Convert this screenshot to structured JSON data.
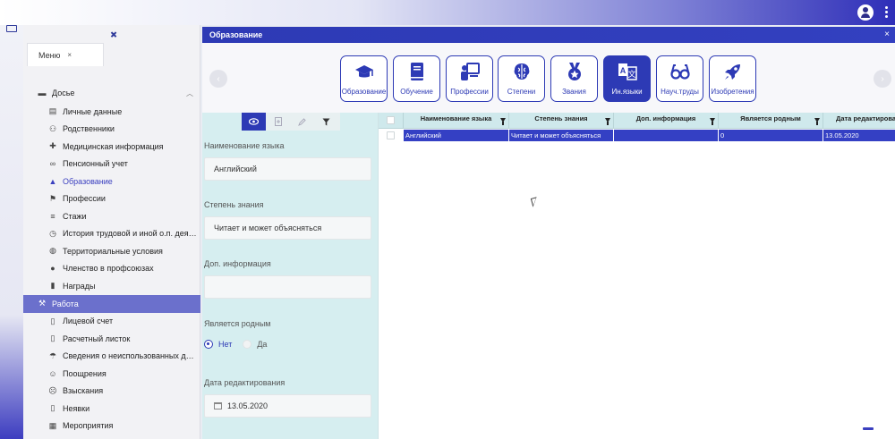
{
  "sidebar": {
    "menu_tab": "Меню",
    "close": "×",
    "items": [
      {
        "type": "group",
        "label": "Досье",
        "icon": "folder-icon",
        "expanded": true
      },
      {
        "type": "item",
        "label": "Личные данные",
        "icon": "id-card-icon"
      },
      {
        "type": "item",
        "label": "Родственники",
        "icon": "people-icon"
      },
      {
        "type": "item",
        "label": "Медицинская информация",
        "icon": "medical-icon"
      },
      {
        "type": "item",
        "label": "Пенсионный учет",
        "icon": "glasses-icon"
      },
      {
        "type": "item",
        "label": "Образование",
        "icon": "graduation-cap-icon",
        "active": true
      },
      {
        "type": "item",
        "label": "Профессии",
        "icon": "profession-icon"
      },
      {
        "type": "item",
        "label": "Стажи",
        "icon": "list-icon"
      },
      {
        "type": "item",
        "label": "История трудовой и иной о.п. дея…",
        "icon": "history-icon"
      },
      {
        "type": "item",
        "label": "Территориальные условия",
        "icon": "globe-icon"
      },
      {
        "type": "item",
        "label": "Членство в профсоюзах",
        "icon": "person-icon"
      },
      {
        "type": "item",
        "label": "Награды",
        "icon": "award-icon"
      },
      {
        "type": "group",
        "label": "Работа",
        "icon": "work-icon",
        "selected": true
      },
      {
        "type": "item",
        "label": "Лицевой счет",
        "icon": "document-icon"
      },
      {
        "type": "item",
        "label": "Расчетный листок",
        "icon": "document-icon"
      },
      {
        "type": "item",
        "label": "Сведения о неиспользованных д…",
        "icon": "beach-icon"
      },
      {
        "type": "item",
        "label": "Поощрения",
        "icon": "smile-icon"
      },
      {
        "type": "item",
        "label": "Взыскания",
        "icon": "frown-icon"
      },
      {
        "type": "item",
        "label": "Неявки",
        "icon": "document-icon"
      },
      {
        "type": "item",
        "label": "Мероприятия",
        "icon": "calendar-icon"
      }
    ]
  },
  "panel": {
    "title": "Образование",
    "close": "×"
  },
  "tabs": [
    {
      "label": "Образование",
      "icon": "graduation-cap-icon"
    },
    {
      "label": "Обучение",
      "icon": "book-icon"
    },
    {
      "label": "Профессии",
      "icon": "presentation-icon"
    },
    {
      "label": "Степени",
      "icon": "brain-icon"
    },
    {
      "label": "Звания",
      "icon": "medal-icon"
    },
    {
      "label": "Ин.языки",
      "icon": "translate-icon",
      "active": true
    },
    {
      "label": "Науч.труды",
      "icon": "glasses-icon"
    },
    {
      "label": "Изобретения",
      "icon": "rocket-icon"
    }
  ],
  "form": {
    "fields": [
      {
        "label": "Наименование языка",
        "value": "Английский"
      },
      {
        "label": "Степень знания",
        "value": "Читает и может объясняться"
      },
      {
        "label": "Доп. информация",
        "value": ""
      },
      {
        "label": "Является родным"
      },
      {
        "label": "Дата редактирования",
        "value": "13.05.2020"
      }
    ],
    "radio": {
      "yes": "Да",
      "no": "Нет",
      "selected": "no"
    }
  },
  "grid": {
    "columns": [
      "Наименование языка",
      "Степень знания",
      "Доп. информация",
      "Является родным",
      "Дата редактирования"
    ],
    "rows": [
      [
        "Английский",
        "Читает и может объясняться",
        "",
        "0",
        "13.05.2020"
      ]
    ]
  },
  "colors": {
    "accent": "#2d3ab5",
    "form_bg": "#d6eef0",
    "selected_row": "#3440c4"
  }
}
